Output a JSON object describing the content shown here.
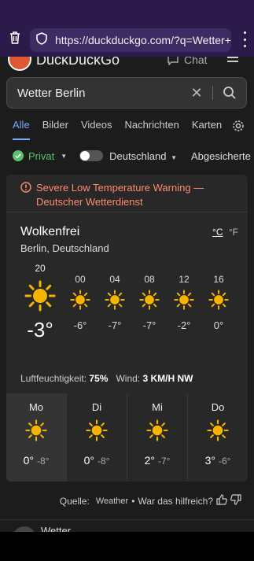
{
  "browser": {
    "url": "https://duckduckgo.com/?q=Wetter+Berlin",
    "colors": {
      "chrome": "#2b1a4a",
      "field": "#3d2c63"
    }
  },
  "header": {
    "brand": "DuckDuckGo",
    "chat_label": "Chat"
  },
  "search": {
    "query": "Wetter Berlin"
  },
  "tabs": [
    "Alle",
    "Bilder",
    "Videos",
    "Nachrichten",
    "Karten"
  ],
  "filters": {
    "privacy": "Privat",
    "region": "Deutschland",
    "safe_search": "Abgesicherte"
  },
  "weather": {
    "warning": "Severe Low Temperature Warning — Deutscher Wetterdienst",
    "condition": "Wolkenfrei",
    "location": "Berlin, Deutschland",
    "unit_c": "°C",
    "unit_f": "°F",
    "now": {
      "label": "20",
      "temp": "-3°",
      "icon": "sun-icon"
    },
    "hours": [
      {
        "label": "00",
        "temp": "-6°"
      },
      {
        "label": "04",
        "temp": "-7°"
      },
      {
        "label": "08",
        "temp": "-7°"
      },
      {
        "label": "12",
        "temp": "-2°"
      },
      {
        "label": "16",
        "temp": "0°"
      }
    ],
    "humidity_label": "Luftfeuchtigkeit:",
    "humidity": "75%",
    "wind_label": "Wind:",
    "wind": "3 KM/H NW",
    "days": [
      {
        "name": "Mo",
        "high": "0°",
        "low": "-8°"
      },
      {
        "name": "Di",
        "high": "0°",
        "low": "-8°"
      },
      {
        "name": "Mi",
        "high": "2°",
        "low": "-7°"
      },
      {
        "name": "Do",
        "high": "3°",
        "low": "-6°"
      }
    ],
    "colors": {
      "warning": "#ff8b73",
      "sun": "#f5b400",
      "accent": "#7aa8ff",
      "privat": "#57c26b"
    }
  },
  "source": {
    "prefix": "Quelle:",
    "provider": "Weather",
    "separator": "•",
    "feedback": "War das hilfreich?"
  },
  "next_result": {
    "title": "Wetter"
  }
}
